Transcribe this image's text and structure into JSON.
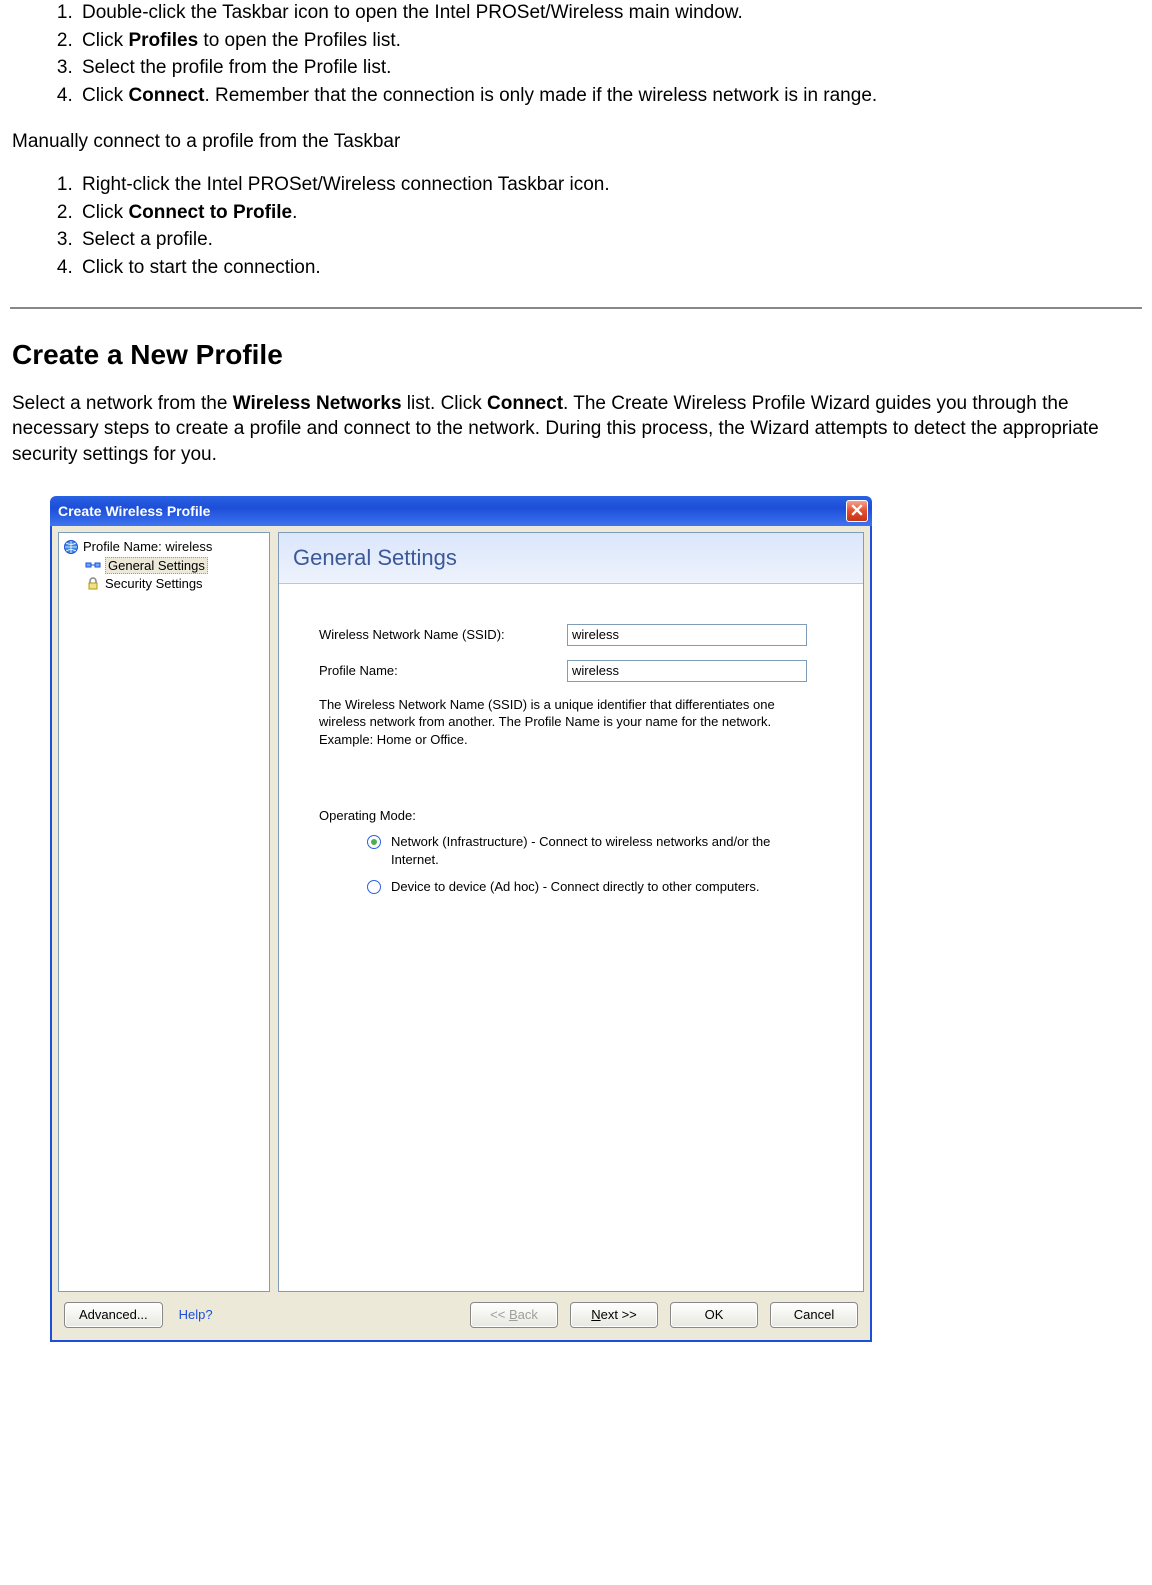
{
  "list_a": {
    "i1_pre": "Double-click the Taskbar icon to open the Intel PROSet/Wireless main window.",
    "i2_pre": "Click ",
    "i2_bold": "Profiles",
    "i2_post": " to open the Profiles list.",
    "i3": "Select the profile from the Profile list.",
    "i4_pre": "Click ",
    "i4_bold": "Connect",
    "i4_post": ". Remember that the connection is only made if the wireless network is in range."
  },
  "para_manual": "Manually connect to a profile from the Taskbar",
  "list_b": {
    "i1": "Right-click the Intel PROSet/Wireless connection Taskbar icon.",
    "i2_pre": "Click ",
    "i2_bold": "Connect to Profile",
    "i2_post": ".",
    "i3": "Select a profile.",
    "i4": "Click to start the connection."
  },
  "heading_create": "Create a New Profile",
  "intro": {
    "p1": "Select a network from the ",
    "b1": "Wireless Networks",
    "p2": " list. Click ",
    "b2": "Connect",
    "p3": ". The Create Wireless Profile Wizard guides you through the necessary steps to create a profile and connect to the network. During this process, the Wizard attempts to detect the appropriate security settings for you."
  },
  "wizard": {
    "title": "Create Wireless Profile",
    "tree": {
      "root": "Profile Name: wireless",
      "general": "General Settings",
      "security": "Security Settings"
    },
    "panel_title": "General Settings",
    "form": {
      "ssid_label": "Wireless Network Name (SSID):",
      "ssid_value": "wireless",
      "profile_label": "Profile Name:",
      "profile_value": "wireless",
      "help": "The Wireless Network Name (SSID) is a unique identifier that differentiates one wireless network from another. The Profile Name is your name for the network. Example: Home or Office.",
      "opmode": "Operating Mode:",
      "radio1": "Network (Infrastructure) - Connect to wireless networks and/or the Internet.",
      "radio2": "Device to device (Ad hoc) - Connect directly to other computers."
    },
    "buttons": {
      "advanced": "Advanced...",
      "help": "Help?",
      "back_pre": "<< ",
      "back_under": "B",
      "back_post": "ack",
      "next_under": "N",
      "next_post": "ext >>",
      "ok": "OK",
      "cancel": "Cancel"
    }
  }
}
